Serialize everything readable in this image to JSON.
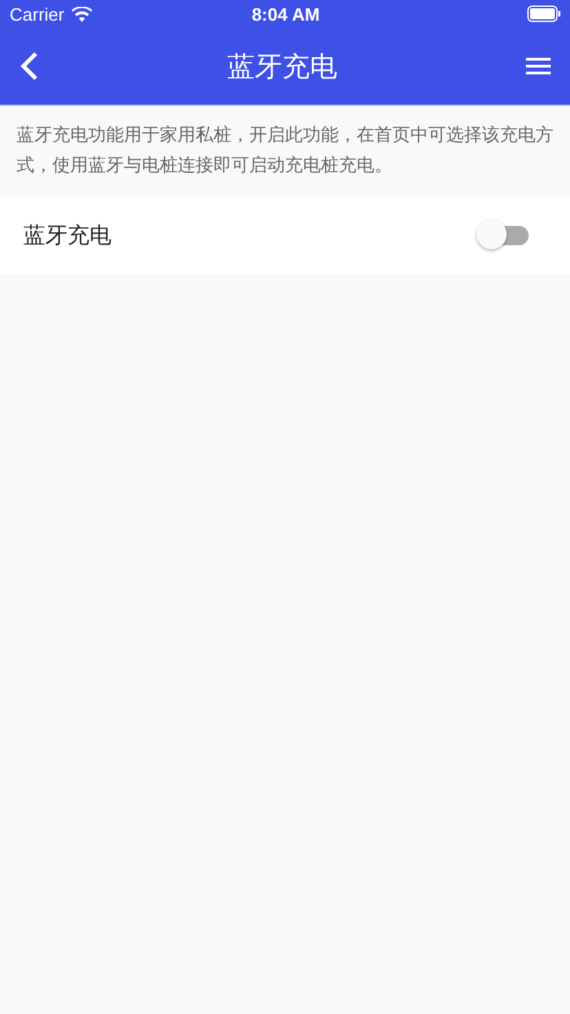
{
  "status_bar": {
    "carrier": "Carrier",
    "time": "8:04 AM"
  },
  "nav": {
    "title": "蓝牙充电"
  },
  "description": "蓝牙充电功能用于家用私桩，开启此功能，在首页中可选择该充电方式，使用蓝牙与电桩连接即可启动充电桩充电。",
  "settings": [
    {
      "label": "蓝牙充电",
      "on": false
    }
  ]
}
